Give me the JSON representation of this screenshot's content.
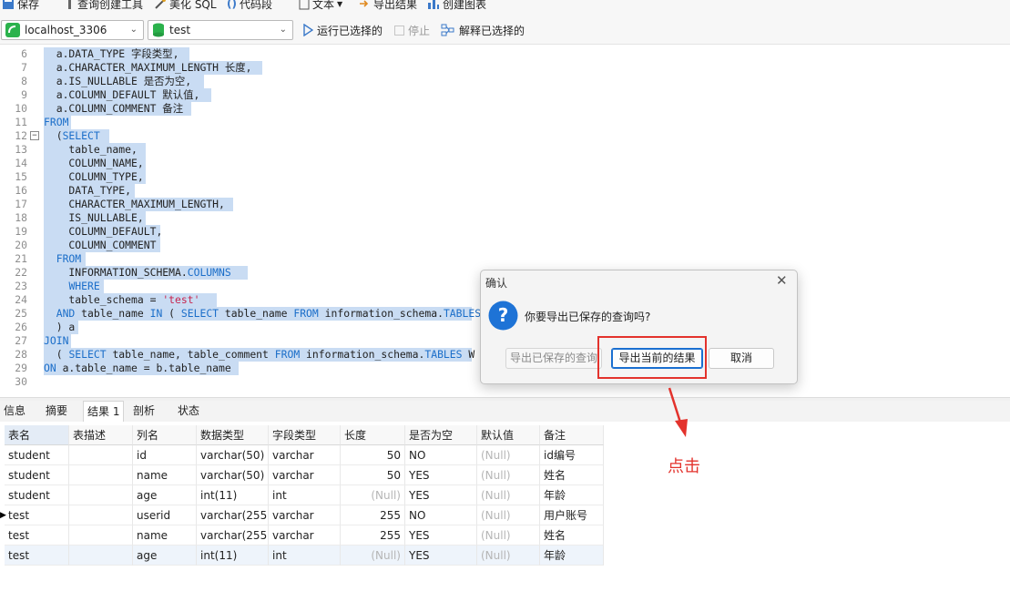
{
  "toolbar1": {
    "save": "保存",
    "query_builder": "查询创建工具",
    "beautify": "美化 SQL",
    "snippet": "代码段",
    "text": "文本",
    "export_result": "导出结果",
    "create_chart": "创建图表"
  },
  "toolbar2": {
    "connection": "localhost_3306",
    "database": "test",
    "run_selected": "运行已选择的",
    "stop": "停止",
    "explain_selected": "解释已选择的"
  },
  "editor": {
    "lines": [
      {
        "n": "6",
        "code": "  a.DATA_TYPE 字段类型,"
      },
      {
        "n": "7",
        "code": "  a.CHARACTER_MAXIMUM_LENGTH 长度,"
      },
      {
        "n": "8",
        "code": "  a.IS_NULLABLE 是否为空,"
      },
      {
        "n": "9",
        "code": "  a.COLUMN_DEFAULT 默认值,"
      },
      {
        "n": "10",
        "code": "  a.COLUMN_COMMENT 备注"
      },
      {
        "n": "11",
        "code": "FROM"
      },
      {
        "n": "12",
        "code": "  (SELECT"
      },
      {
        "n": "13",
        "code": "    table_name,"
      },
      {
        "n": "14",
        "code": "    COLUMN_NAME,"
      },
      {
        "n": "15",
        "code": "    COLUMN_TYPE,"
      },
      {
        "n": "16",
        "code": "    DATA_TYPE,"
      },
      {
        "n": "17",
        "code": "    CHARACTER_MAXIMUM_LENGTH,"
      },
      {
        "n": "18",
        "code": "    IS_NULLABLE,"
      },
      {
        "n": "19",
        "code": "    COLUMN_DEFAULT,"
      },
      {
        "n": "20",
        "code": "    COLUMN_COMMENT"
      },
      {
        "n": "21",
        "code": "  FROM"
      },
      {
        "n": "22",
        "code": "    INFORMATION_SCHEMA.COLUMNS"
      },
      {
        "n": "23",
        "code": "    WHERE"
      },
      {
        "n": "24",
        "code": "    table_schema = 'test'"
      },
      {
        "n": "25",
        "code": "  AND table_name IN ( SELECT table_name FROM information_schema.TABLES"
      },
      {
        "n": "26",
        "code": "  ) a"
      },
      {
        "n": "27",
        "code": "JOIN"
      },
      {
        "n": "28",
        "code": "  ( SELECT table_name, table_comment FROM information_schema.TABLES W"
      },
      {
        "n": "29",
        "code": "ON a.table_name = b.table_name"
      },
      {
        "n": "30",
        "code": ""
      }
    ]
  },
  "result_tabs": [
    "信息",
    "摘要",
    "结果 1",
    "剖析",
    "状态"
  ],
  "grid": {
    "columns": [
      "表名",
      "表描述",
      "列名",
      "数据类型",
      "字段类型",
      "长度",
      "是否为空",
      "默认值",
      "备注"
    ],
    "null_text": "(Null)",
    "rows": [
      [
        "student",
        "",
        "id",
        "varchar(50)",
        "varchar",
        "50",
        "NO",
        "(Null)",
        "id编号"
      ],
      [
        "student",
        "",
        "name",
        "varchar(50)",
        "varchar",
        "50",
        "YES",
        "(Null)",
        "姓名"
      ],
      [
        "student",
        "",
        "age",
        "int(11)",
        "int",
        "(Null)",
        "YES",
        "(Null)",
        "年龄"
      ],
      [
        "test",
        "",
        "userid",
        "varchar(255)",
        "varchar",
        "255",
        "NO",
        "(Null)",
        "用户账号"
      ],
      [
        "test",
        "",
        "name",
        "varchar(255)",
        "varchar",
        "255",
        "YES",
        "(Null)",
        "姓名"
      ],
      [
        "test",
        "",
        "age",
        "int(11)",
        "int",
        "(Null)",
        "YES",
        "(Null)",
        "年龄"
      ]
    ]
  },
  "dialog": {
    "title": "确认",
    "message": "你要导出已保存的查询吗?",
    "btn_saved": "导出已保存的查询",
    "btn_current": "导出当前的结果",
    "btn_cancel": "取消"
  },
  "annotation": {
    "label": "点击",
    "color": "#e3322c"
  }
}
